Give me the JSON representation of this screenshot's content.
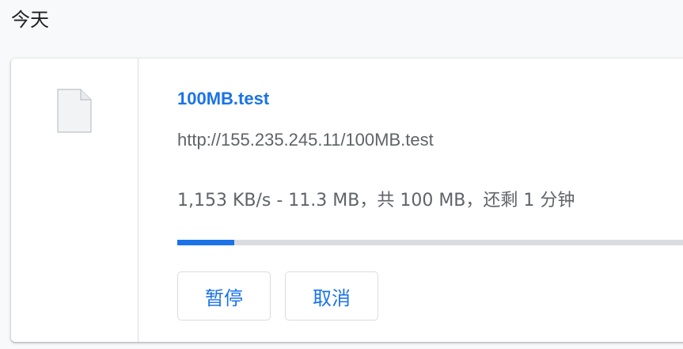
{
  "section": {
    "date_label": "今天"
  },
  "download": {
    "file_name": "100MB.test",
    "url": "http://155.235.245.11/100MB.test",
    "status_text": "1,153 KB/s - 11.3 MB，共 100 MB，还剩 1 分钟",
    "progress_percent": 11.3,
    "icon": "file-icon"
  },
  "actions": {
    "pause_label": "暂停",
    "cancel_label": "取消"
  },
  "colors": {
    "accent": "#1a73e8",
    "secondary_text": "#5f6368",
    "border": "#dadce0",
    "page_background": "#f8f9fa"
  }
}
